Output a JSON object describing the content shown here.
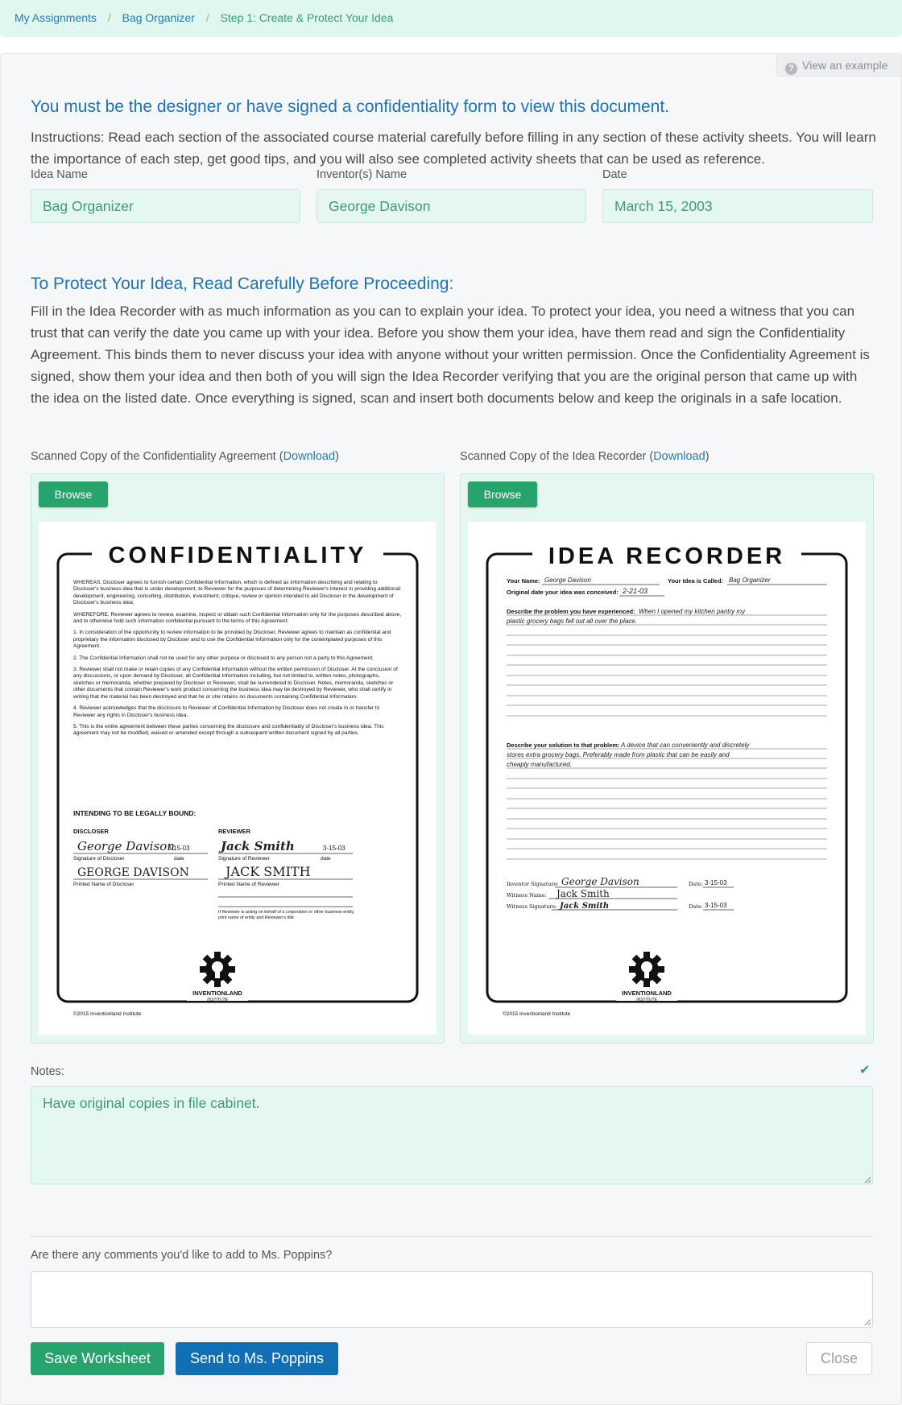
{
  "breadcrumb": {
    "items": [
      "My Assignments",
      "Bag Organizer"
    ],
    "current": "Step 1: Create & Protect Your Idea",
    "separator": "/"
  },
  "example_link": "View an example",
  "heading": "You must be the designer or have signed a confidentiality form to view this document.",
  "instructions": "Instructions: Read each section of the associated course material carefully before filling in any section of these activity sheets. You will learn the importance of each step, get good tips, and you will also see completed activity sheets that can be used as reference.",
  "fields": {
    "idea_name": {
      "label": "Idea Name",
      "value": "Bag Organizer"
    },
    "inventor": {
      "label": "Inventor(s) Name",
      "value": "George Davison"
    },
    "date": {
      "label": "Date",
      "value": "March 15, 2003"
    }
  },
  "protect_heading": "To Protect Your Idea, Read Carefully Before Proceeding:",
  "protect_text": "Fill in the Idea Recorder with as much information as you can to explain your idea. To protect your idea, you need a witness that you can trust that can verify the date you came up with your idea. Before you show them your idea, have them read and sign the Confidentiality Agreement. This binds them to never discuss your idea with anyone without your written permission. Once the Confidentiality Agreement is signed, show them your idea and then both of you will sign the Idea Recorder verifying that you are the original person that came up with the idea on the listed date. Once everything is signed, scan and insert both documents below and keep the originals in a safe location.",
  "scans": {
    "confidentiality": {
      "label": "Scanned Copy of the Confidentiality Agreement (",
      "link": "Download",
      "close": ")",
      "browse": "Browse",
      "doc": {
        "title": "CONFIDENTIALITY",
        "p1": "WHEREAS, Discloser agrees to furnish certain Confidential Information, which is defined as information describing and relating to Discloser's business idea that is under development, to Reviewer for the purposes of determining Reviewer's interest in providing additional development, engineering, consulting, distribution, investment, critique, review or opinion intended to aid Discloser in the development of Discloser's business idea;",
        "p2": "WHEREFORE, Reviewer agrees to review, examine, inspect or obtain such Confidential Information only for the purposes described above, and to otherwise hold such information confidential pursuant to the terms of this Agreement:",
        "p3": "1. In consideration of the opportunity to review information to be provided by Discloser, Reviewer agrees to maintain as confidential and proprietary the information disclosed by Discloser and to use the Confidential Information only for the contemplated purposes of this Agreement.",
        "p4": "2. The Confidential Information shall not be used for any other purpose or disclosed to any person not a party to this Agreement.",
        "p5": "3. Reviewer shall not make or retain copies of any Confidential Information without the written permission of Discloser. At the conclusion of any discussions, or upon demand by Discloser, all Confidential Information including, but not limited to, written notes, photographs, sketches or memoranda, whether prepared by Discloser or Reviewer, shall be surrendered to Discloser. Notes, memoranda, sketches or other documents that contain Reviewer's work product concerning the business idea may be destroyed by Reviewer, who shall certify in writing that the material has been destroyed and that he or she retains no documents containing Confidential Information.",
        "p6": "4. Reviewer acknowledges that the disclosure to Reviewer of Confidential Information by Discloser does not create in or transfer to Reviewer any rights in Discloser's business idea.",
        "p7": "5. This is the entire agreement between these parties concerning the disclosure and confidentiality of Discloser's business idea. This agreement may not be modified, waived or amended except through a subsequent written document signed by all parties.",
        "intending": "INTENDING TO BE LEGALLY BOUND:",
        "discloser": "DISCLOSER",
        "reviewer": "REVIEWER",
        "sig_discloser": "Signature of Discloser",
        "sig_reviewer": "Signature of Reviewer",
        "date_word": "date",
        "printed_discloser": "Printed Name of Discloser",
        "printed_reviewer": "Printed Name of Reviewer",
        "hw_discloser_sig": "George Davison",
        "hw_discloser_date": "3-15-03",
        "hw_reviewer_sig": "Jack Smith",
        "hw_reviewer_date": "3-15-03",
        "hw_discloser_name": "GEORGE DAVISON",
        "hw_reviewer_name": "JACK SMITH",
        "entity_note": "If Reviewer is acting on behalf of a corporation or other business entity, print name of entity and Reviewer's title",
        "logo": "INVENTIONLAND",
        "logo_sub": "INSTITUTE",
        "footer": "©2015 Inventionland Institute"
      }
    },
    "recorder": {
      "label": "Scanned Copy of the Idea Recorder (",
      "link": "Download",
      "close": ")",
      "browse": "Browse",
      "doc": {
        "title": "IDEA RECORDER",
        "your_name": "Your Name:",
        "hw_name": "George Davison",
        "idea_called": "Your Idea is Called:",
        "hw_idea": "Bag Organizer",
        "original_date": "Original date your idea was conceived:",
        "hw_date": "2-21-03",
        "problem_label": "Describe the problem you have experienced:",
        "hw_problem_1": "When I opened my kitchen pantry my",
        "hw_problem_2": "plastic grocery bags fell out all over the place.",
        "solution_label": "Describe your solution to that problem:",
        "hw_solution_1": "A device that can conveniently and discretely",
        "hw_solution_2": "stores extra grocery bags. Preferably made from plastic that can be easily and",
        "hw_solution_3": "cheaply manufactured.",
        "inventor_sig": "Inventor Signature:",
        "witness_name": "Witness Name:",
        "witness_sig": "Witness Signature:",
        "date_label": "Date:",
        "hw_inventor_sig": "George Davison",
        "hw_inventor_date": "3-15-03",
        "hw_witness_name": "Jack Smith",
        "hw_witness_sig": "Jack Smith",
        "hw_witness_date": "3-15-03",
        "logo": "INVENTIONLAND",
        "logo_sub": "INSTITUTE",
        "footer": "©2015 Inventionland Institute"
      }
    }
  },
  "notes": {
    "label": "Notes:",
    "value": "Have original copies in file cabinet.",
    "check_icon": "check-icon"
  },
  "comment": {
    "label": "Are there any comments you'd like to add to Ms. Poppins?",
    "value": ""
  },
  "buttons": {
    "save": "Save Worksheet",
    "send": "Send to Ms. Poppins",
    "close": "Close"
  },
  "colors": {
    "accent_green": "#27a36e",
    "accent_blue": "#1170b5",
    "heading_blue": "#1e72b5",
    "field_bg": "#e5f8f0"
  }
}
